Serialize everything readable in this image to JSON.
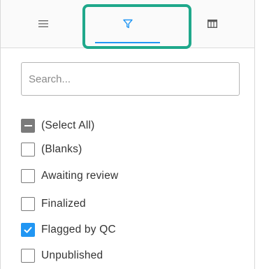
{
  "tabs": [
    {
      "id": "general",
      "icon": "hamburger-menu-icon",
      "active": false
    },
    {
      "id": "filter",
      "icon": "filter-icon",
      "active": true
    },
    {
      "id": "columns",
      "icon": "columns-icon",
      "active": false
    }
  ],
  "search": {
    "placeholder": "Search...",
    "value": ""
  },
  "filter_items": [
    {
      "label": "(Select All)",
      "state": "indeterminate"
    },
    {
      "label": "(Blanks)",
      "state": "unchecked"
    },
    {
      "label": "Awaiting review",
      "state": "unchecked"
    },
    {
      "label": "Finalized",
      "state": "unchecked"
    },
    {
      "label": "Flagged by QC",
      "state": "checked"
    },
    {
      "label": "Unpublished",
      "state": "unchecked"
    }
  ],
  "colors": {
    "accent": "#2196f3",
    "highlight": "#1fa88b",
    "indeterminate": "#7b7b7b",
    "text": "#333333"
  }
}
